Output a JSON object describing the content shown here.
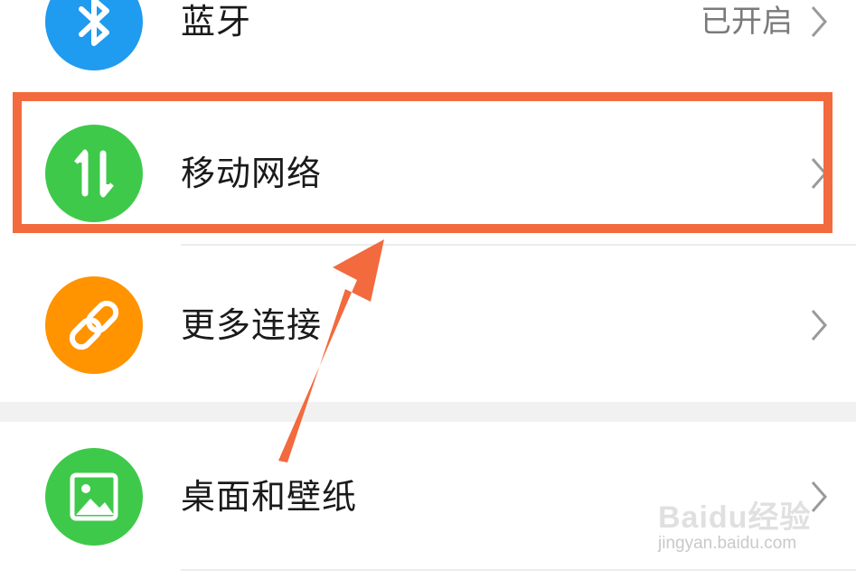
{
  "settings": {
    "items": [
      {
        "label": "蓝牙",
        "status": "已开启",
        "icon": "bluetooth-icon",
        "icon_color": "#1f9bef"
      },
      {
        "label": "移动网络",
        "status": "",
        "icon": "data-transfer-arrows-icon",
        "icon_color": "#3ec94a"
      },
      {
        "label": "更多连接",
        "status": "",
        "icon": "link-chain-icon",
        "icon_color": "#ff9300"
      },
      {
        "label": "桌面和壁纸",
        "status": "",
        "icon": "image-icon",
        "icon_color": "#3ec94a"
      }
    ]
  },
  "annotation": {
    "highlight_color": "#f26a3d",
    "highlighted_item": "移动网络"
  },
  "watermark": {
    "brand": "Baidu经验",
    "url": "jingyan.baidu.com"
  }
}
